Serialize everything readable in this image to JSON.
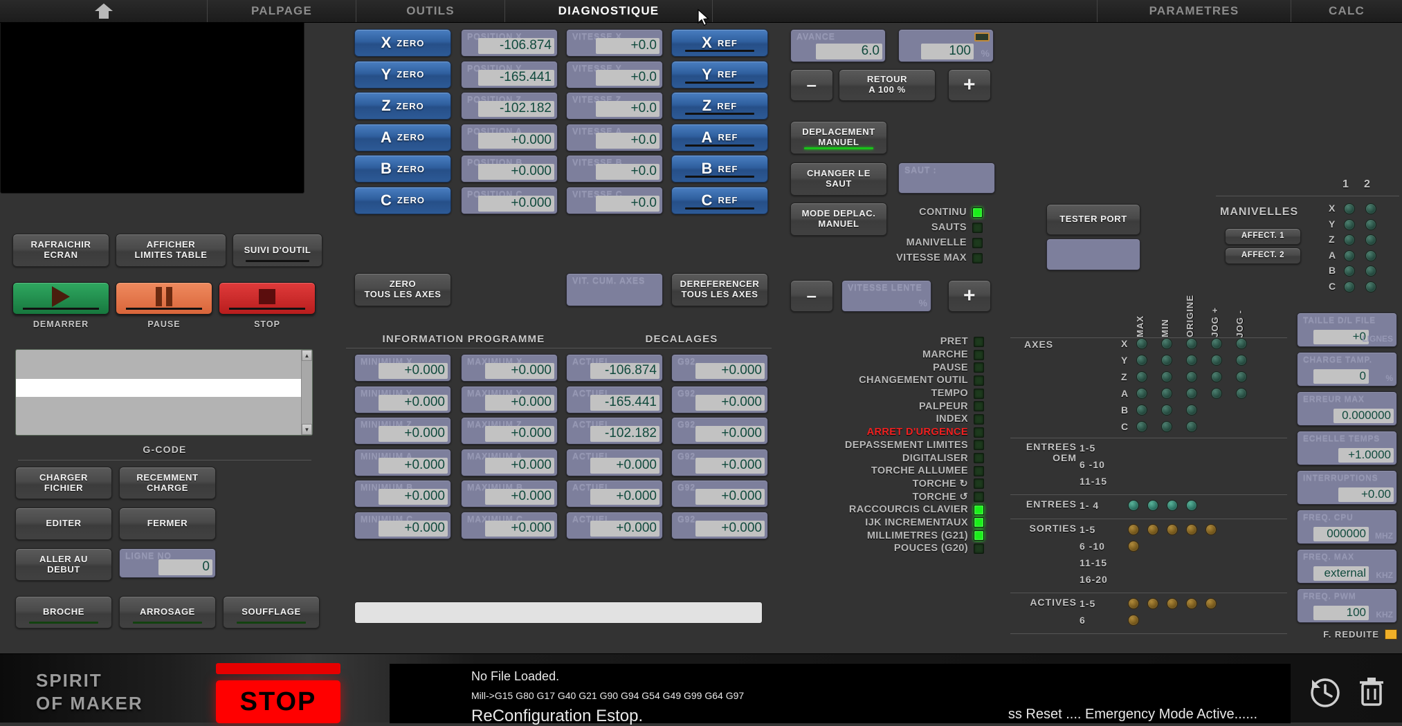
{
  "nav": {
    "home_icon": "home-icon",
    "tabs": [
      {
        "label": "PALPAGE",
        "active": false
      },
      {
        "label": "OUTILS",
        "active": false
      },
      {
        "label": "DIAGNOSTIQUE",
        "active": true
      },
      {
        "label": "",
        "active": false
      },
      {
        "label": "PARAMETRES",
        "active": false
      },
      {
        "label": "CALC",
        "active": false
      }
    ]
  },
  "left": {
    "refresh_screen": "RAFRAICHIR\nECRAN",
    "refresh_screen_l1": "RAFRAICHIR",
    "refresh_screen_l2": "ECRAN",
    "show_limits_l1": "AFFICHER",
    "show_limits_l2": "LIMITES TABLE",
    "tool_follow": "SUIVI D'OUTIL",
    "start_caption": "DEMARRER",
    "pause_caption": "PAUSE",
    "stop_caption": "STOP",
    "gcode_title": "G-CODE",
    "load_file_l1": "CHARGER",
    "load_file_l2": "FICHIER",
    "recent_l1": "RECEMMENT",
    "recent_l2": "CHARGE",
    "edit": "EDITER",
    "close": "FERMER",
    "goto_start_l1": "ALLER AU",
    "goto_start_l2": "DEBUT",
    "line_no_label": "LIGNE NO",
    "line_no_value": "0",
    "spindle": "BROCHE",
    "coolant": "ARROSAGE",
    "blow": "SOUFFLAGE"
  },
  "axes": {
    "zero_suffix": "ZERO",
    "ref_suffix": "REF",
    "rows": [
      {
        "axis": "X",
        "pos_label": "POSITION  X",
        "pos_value": "-106.874",
        "vel_label": "VITESSE  X",
        "vel_value": "+0.0"
      },
      {
        "axis": "Y",
        "pos_label": "POSITION  Y",
        "pos_value": "-165.441",
        "vel_label": "VITESSE  Y",
        "vel_value": "+0.0"
      },
      {
        "axis": "Z",
        "pos_label": "POSITION  Z",
        "pos_value": "-102.182",
        "vel_label": "VITESSE  Z",
        "vel_value": "+0.0"
      },
      {
        "axis": "A",
        "pos_label": "POSITION  A",
        "pos_value": "+0.000",
        "vel_label": "VITESSE  A",
        "vel_value": "+0.0"
      },
      {
        "axis": "B",
        "pos_label": "POSITION  B",
        "pos_value": "+0.000",
        "vel_label": "VITESSE  B",
        "vel_value": "+0.0"
      },
      {
        "axis": "C",
        "pos_label": "POSITION  C",
        "pos_value": "+0.000",
        "vel_label": "VITESSE  C",
        "vel_value": "+0.0"
      }
    ],
    "zero_all_l1": "ZERO",
    "zero_all_l2": "TOUS LES AXES",
    "cum_speed_label": "VIT. CUM. AXES",
    "deref_all_l1": "DEREFERENCER",
    "deref_all_l2": "TOUS LES AXES"
  },
  "program": {
    "info_title": "INFORMATION PROGRAMME",
    "offsets_title": "DECALAGES",
    "rows": [
      {
        "min_label": "MINIMUM  X",
        "min_value": "+0.000",
        "max_label": "MAXIMUM  X",
        "max_value": "+0.000",
        "cur_label": "ACTUEL",
        "cur_value": "-106.874",
        "g92_label": "G92",
        "g92_value": "+0.000"
      },
      {
        "min_label": "MINIMUM  Y",
        "min_value": "+0.000",
        "max_label": "MAXIMUM  Y",
        "max_value": "+0.000",
        "cur_label": "ACTUEL",
        "cur_value": "-165.441",
        "g92_label": "G92",
        "g92_value": "+0.000"
      },
      {
        "min_label": "MINIMUM  Z",
        "min_value": "+0.000",
        "max_label": "MAXIMUM  Z",
        "max_value": "+0.000",
        "cur_label": "ACTUEL",
        "cur_value": "-102.182",
        "g92_label": "G92",
        "g92_value": "+0.000"
      },
      {
        "min_label": "MINIMUM  A",
        "min_value": "+0.000",
        "max_label": "MAXIMUM  A",
        "max_value": "+0.000",
        "cur_label": "ACTUEL",
        "cur_value": "+0.000",
        "g92_label": "G92",
        "g92_value": "+0.000"
      },
      {
        "min_label": "MINIMUM  B",
        "min_value": "+0.000",
        "max_label": "MAXIMUM  B",
        "max_value": "+0.000",
        "cur_label": "ACTUEL",
        "cur_value": "+0.000",
        "g92_label": "G92",
        "g92_value": "+0.000"
      },
      {
        "min_label": "MINIMUM  C",
        "min_value": "+0.000",
        "max_label": "MAXIMUM  C",
        "max_value": "+0.000",
        "cur_label": "ACTUEL",
        "cur_value": "+0.000",
        "g92_label": "G92",
        "g92_value": "+0.000"
      }
    ]
  },
  "feed": {
    "avance_label": "AVANCE",
    "avance_value": "6.0",
    "override_value": "100",
    "override_unit": "%",
    "minus": "–",
    "plus": "+",
    "reset_l1": "RETOUR",
    "reset_l2": "A 100 %",
    "manual_move_l1": "DEPLACEMENT",
    "manual_move_l2": "MANUEL",
    "change_jump_l1": "CHANGER LE",
    "change_jump_l2": "SAUT",
    "jump_label": "SAUT :",
    "jump_value": "",
    "move_mode_l1": "MODE DEPLAC.",
    "move_mode_l2": "MANUEL",
    "slow_speed_label": "VITESSE LENTE",
    "slow_speed_unit": "%",
    "modes": [
      {
        "label": "CONTINU",
        "on": true
      },
      {
        "label": "SAUTS",
        "on": false
      },
      {
        "label": "MANIVELLE",
        "on": false
      },
      {
        "label": "VITESSE MAX",
        "on": false
      }
    ]
  },
  "status_leds": [
    {
      "label": "PRET",
      "on": false,
      "alarm": false
    },
    {
      "label": "MARCHE",
      "on": false,
      "alarm": false
    },
    {
      "label": "PAUSE",
      "on": false,
      "alarm": false
    },
    {
      "label": "CHANGEMENT OUTIL",
      "on": false,
      "alarm": false
    },
    {
      "label": "TEMPO",
      "on": false,
      "alarm": false
    },
    {
      "label": "PALPEUR",
      "on": false,
      "alarm": false
    },
    {
      "label": "INDEX",
      "on": false,
      "alarm": false
    },
    {
      "label": "ARRET D'URGENCE",
      "on": false,
      "alarm": true
    },
    {
      "label": "DEPASSEMENT LIMITES",
      "on": false,
      "alarm": false
    },
    {
      "label": "DIGITALISER",
      "on": false,
      "alarm": false
    },
    {
      "label": "TORCHE ALLUMEE",
      "on": false,
      "alarm": false
    },
    {
      "label": "TORCHE ↻",
      "on": false,
      "alarm": false
    },
    {
      "label": "TORCHE ↺",
      "on": false,
      "alarm": false
    },
    {
      "label": "RACCOURCIS CLAVIER",
      "on": true,
      "alarm": false
    },
    {
      "label": "IJK INCREMENTAUX",
      "on": true,
      "alarm": false
    },
    {
      "label": "MILLIMETRES (G21)",
      "on": true,
      "alarm": false
    },
    {
      "label": "POUCES (G20)",
      "on": false,
      "alarm": false
    }
  ],
  "diag": {
    "test_port": "TESTER PORT",
    "test_port_value": "",
    "axes_label": "AXES",
    "col_headers": [
      "MAX",
      "MIN",
      "ORIGINE",
      "JOG +",
      "JOG -"
    ],
    "axis_names": [
      "X",
      "Y",
      "Z",
      "A",
      "B",
      "C"
    ],
    "axis_dots": [
      [
        1,
        1,
        1,
        1,
        1
      ],
      [
        1,
        1,
        1,
        1,
        1
      ],
      [
        1,
        1,
        1,
        1,
        1
      ],
      [
        1,
        1,
        1,
        1,
        1
      ],
      [
        1,
        1,
        1,
        0,
        0
      ],
      [
        1,
        1,
        1,
        0,
        0
      ]
    ],
    "groups": [
      {
        "label_l1": "ENTREES",
        "label_l2": "OEM",
        "ranges": [
          "1-5",
          "6 -10",
          "11-15"
        ],
        "dots": [
          [],
          [],
          []
        ],
        "color": "teal"
      },
      {
        "label_l1": "ENTREES",
        "label_l2": "",
        "ranges": [
          "1- 4"
        ],
        "dots": [
          [
            1,
            1,
            1,
            1
          ]
        ],
        "color": "teal"
      },
      {
        "label_l1": "SORTIES",
        "label_l2": "",
        "ranges": [
          "1-5",
          "6 -10",
          "11-15",
          "16-20"
        ],
        "dots": [
          [
            1,
            1,
            1,
            1,
            1
          ],
          [
            1
          ],
          [],
          []
        ],
        "color": "amber"
      },
      {
        "label_l1": "ACTIVES",
        "label_l2": "",
        "ranges": [
          "1-5",
          "6"
        ],
        "dots": [
          [
            1,
            1,
            1,
            1,
            1
          ],
          [
            1
          ]
        ],
        "color": "amber"
      }
    ]
  },
  "handwheels": {
    "title": "MANIVELLES",
    "col_headers": [
      "1",
      "2"
    ],
    "assign_1": "AFFECT. 1",
    "assign_2": "AFFECT. 2",
    "axis_names": [
      "X",
      "Y",
      "Z",
      "A",
      "B",
      "C"
    ]
  },
  "metrics": [
    {
      "label": "TAILLE D/L FILE",
      "value": "+0",
      "unit": "LIGNES"
    },
    {
      "label": "CHARGE TAMP.",
      "value": "0",
      "unit": "%"
    },
    {
      "label": "ERREUR MAX",
      "value": "0.000000",
      "unit": ""
    },
    {
      "label": "ECHELLE TEMPS",
      "value": "+1.0000",
      "unit": ""
    },
    {
      "label": "INTERRUPTIONS",
      "value": "+0.00",
      "unit": ""
    },
    {
      "label": "FREQ. CPU",
      "value": "000000",
      "unit": "MHZ"
    },
    {
      "label": "FREQ. MAX",
      "value": "external",
      "unit": "KHZ"
    },
    {
      "label": "FREQ. PWM",
      "value": "100",
      "unit": "KHZ"
    }
  ],
  "reduced_freq": {
    "label": "F. REDUITE",
    "on": true
  },
  "footer": {
    "brand_l1": "SPIRIT",
    "brand_l2": "OF MAKER",
    "stop_label": "STOP",
    "console_l1": "No File Loaded.",
    "console_l2": "Mill->G15  G80 G17 G40 G21 G90 G94 G54 G49 G99 G64 G97",
    "console_l3": "ReConfiguration Estop.",
    "console_r1": "ss Reset .... Emergency Mode Active......",
    "history_icon": "history-icon",
    "trash_icon": "trash-icon"
  }
}
